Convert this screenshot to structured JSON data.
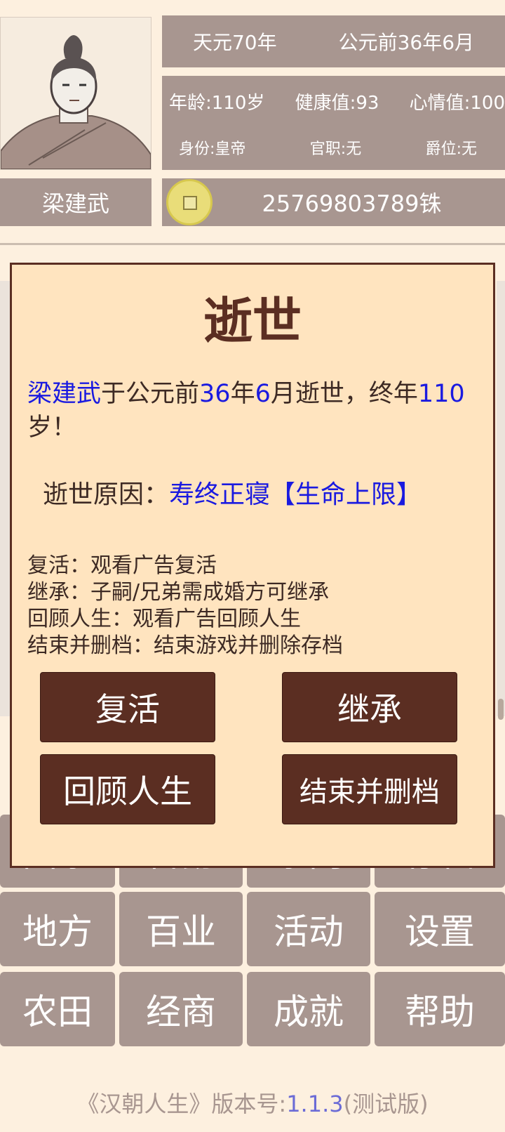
{
  "character": {
    "name": "梁建武"
  },
  "era": {
    "reign": "天元70年",
    "date": "公元前36年6月"
  },
  "stats": {
    "age": "年龄:110岁",
    "health": "健康值:93",
    "mood": "心情值:100",
    "status": "身份:皇帝",
    "office": "官职:无",
    "title": "爵位:无"
  },
  "money": "25769803789铢",
  "nav": {
    "row0": [
      "国家",
      "官爵",
      "家门",
      "存档"
    ],
    "row1": [
      "地方",
      "百业",
      "活动",
      "设置"
    ],
    "row2": [
      "农田",
      "经商",
      "成就",
      "帮助"
    ]
  },
  "footer": {
    "prefix": "《汉朝人生》版本号:",
    "version": "1.1.3",
    "suffix": "(测试版)"
  },
  "modal": {
    "title": "逝世",
    "msg_name": "梁建武",
    "msg_part1": "于公元前",
    "msg_year": "36",
    "msg_part2": "年",
    "msg_month": "6",
    "msg_part3": "月逝世，终年",
    "msg_age": "110",
    "msg_part4": "岁！",
    "cause_label": "逝世原因：",
    "cause_value": "寿终正寝【生命上限】",
    "options": [
      "复活：观看广告复活",
      "继承：子嗣/兄弟需成婚方可继承",
      "回顾人生：观看广告回顾人生",
      "结束并删档：结束游戏并删除存档"
    ],
    "buttons": {
      "revive": "复活",
      "inherit": "继承",
      "review": "回顾人生",
      "end": "结束并删档"
    }
  }
}
